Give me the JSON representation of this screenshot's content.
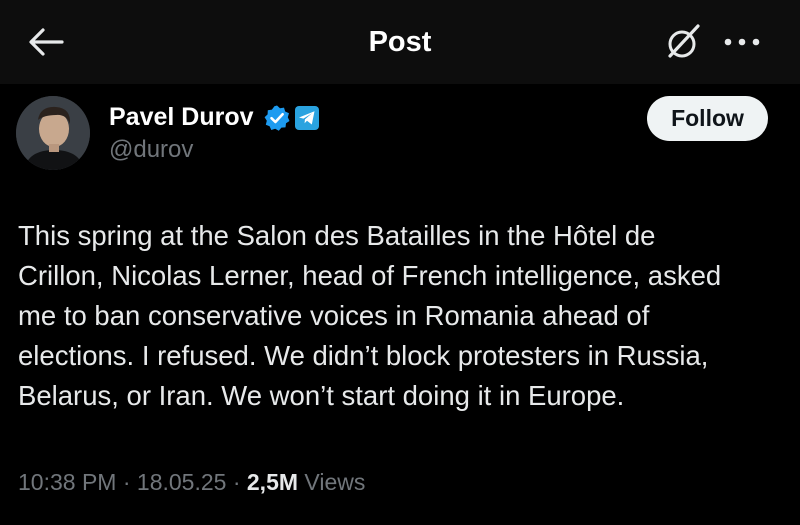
{
  "header": {
    "title": "Post",
    "back_icon": "arrow-left-icon",
    "grok_icon": "grok-icon",
    "more_icon": "more-horizontal-icon"
  },
  "author": {
    "display_name": "Pavel Durov",
    "handle": "@durov",
    "verified_icon": "verified-badge-icon",
    "affiliation_icon": "telegram-icon",
    "follow_label": "Follow"
  },
  "post": {
    "lines": [
      "This spring at the Salon des Batailles in the Hôtel de",
      "Crillon, Nicolas Lerner, head of French intelligence, asked",
      "me to ban conservative voices in Romania ahead of",
      "elections. I refused. We didn’t block protesters in Russia,",
      "Belarus, or Iran. We won’t start doing it in Europe."
    ]
  },
  "meta": {
    "time": "10:38 PM",
    "separator1": " · ",
    "date": "18.05.25",
    "separator2": " · ",
    "views_count": "2,5M",
    "views_label": " Views"
  },
  "colors": {
    "background": "#000000",
    "header_background": "#0d0d0d",
    "primary_text": "#e7e9ea",
    "secondary_text": "#71767b",
    "verified_blue": "#1d9bf0",
    "telegram_blue": "#2aa3e0",
    "follow_button_bg": "#eff3f4"
  }
}
